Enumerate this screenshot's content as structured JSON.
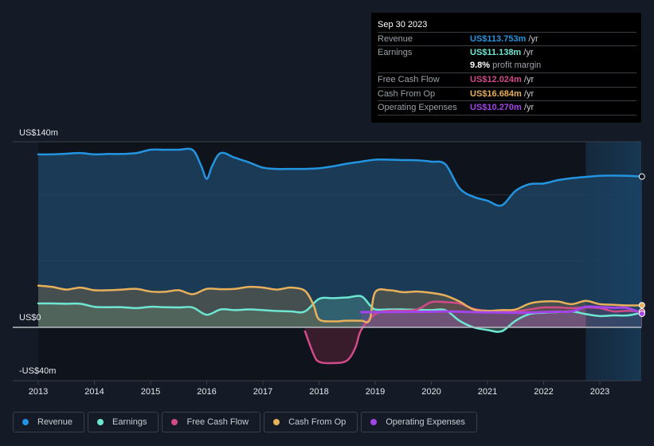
{
  "tooltip": {
    "date": "Sep 30 2023",
    "rows": [
      {
        "label": "Revenue",
        "value": "US$113.753m",
        "unit": " /yr",
        "color": "#2394df"
      },
      {
        "label": "Earnings",
        "value": "US$11.138m",
        "unit": " /yr",
        "color": "#6ee7d2"
      },
      {
        "label": "",
        "value": "9.8%",
        "unit": " profit margin",
        "color": "#ffffff"
      },
      {
        "label": "Free Cash Flow",
        "value": "US$12.024m",
        "unit": " /yr",
        "color": "#d14a8a"
      },
      {
        "label": "Cash From Op",
        "value": "US$16.684m",
        "unit": " /yr",
        "color": "#e8b05a"
      },
      {
        "label": "Operating Expenses",
        "value": "US$10.270m",
        "unit": " /yr",
        "color": "#a345e8"
      }
    ]
  },
  "legend": [
    {
      "label": "Revenue",
      "color": "#2394df"
    },
    {
      "label": "Earnings",
      "color": "#6ee7d2"
    },
    {
      "label": "Free Cash Flow",
      "color": "#d14a8a"
    },
    {
      "label": "Cash From Op",
      "color": "#e8b05a"
    },
    {
      "label": "Operating Expenses",
      "color": "#a345e8"
    }
  ],
  "chart_data": {
    "type": "area",
    "title": "",
    "xlabel": "",
    "ylabel": "",
    "ylim": [
      -40,
      140
    ],
    "xlim": [
      2012.6,
      2023.75
    ],
    "y_tick_labels": [
      {
        "value": 140,
        "label": "US$140m"
      },
      {
        "value": 0,
        "label": "US$0"
      },
      {
        "value": -40,
        "label": "-US$40m"
      }
    ],
    "x_tick_labels": [
      "2013",
      "2014",
      "2015",
      "2016",
      "2017",
      "2018",
      "2019",
      "2020",
      "2021",
      "2022",
      "2023"
    ],
    "grid": true,
    "highlight_region": [
      2022.75,
      2023.75
    ],
    "legend_position": "bottom-left",
    "series": [
      {
        "name": "Revenue",
        "color": "#2394df",
        "x": [
          2013.0,
          2013.25,
          2013.5,
          2013.75,
          2014.0,
          2014.25,
          2014.5,
          2014.75,
          2015.0,
          2015.25,
          2015.5,
          2015.75,
          2015.9,
          2016.0,
          2016.1,
          2016.25,
          2016.5,
          2016.75,
          2017.0,
          2017.25,
          2017.5,
          2017.75,
          2018.0,
          2018.25,
          2018.5,
          2018.75,
          2019.0,
          2019.25,
          2019.5,
          2019.75,
          2020.0,
          2020.25,
          2020.5,
          2020.75,
          2021.0,
          2021.25,
          2021.5,
          2021.75,
          2022.0,
          2022.25,
          2022.5,
          2022.75,
          2023.0,
          2023.25,
          2023.5,
          2023.75
        ],
        "values": [
          130.5,
          130.5,
          131,
          131.5,
          130.5,
          130.8,
          130.8,
          131.5,
          134,
          134,
          134,
          133.8,
          122,
          112,
          122,
          131.5,
          128,
          124.5,
          120.5,
          119.5,
          119.5,
          119.5,
          120,
          121.5,
          123.5,
          125,
          126.5,
          126.5,
          126.2,
          126,
          125,
          123,
          105,
          98.5,
          95.5,
          92,
          103,
          108,
          108.5,
          111,
          112.5,
          113.5,
          114.3,
          114.5,
          114.3,
          113.753
        ]
      },
      {
        "name": "Earnings",
        "color": "#6ee7d2",
        "x": [
          2013.0,
          2013.25,
          2013.5,
          2013.75,
          2014.0,
          2014.25,
          2014.5,
          2014.75,
          2015.0,
          2015.25,
          2015.5,
          2015.75,
          2016.0,
          2016.25,
          2016.5,
          2016.75,
          2017.0,
          2017.25,
          2017.5,
          2017.75,
          2018.0,
          2018.25,
          2018.5,
          2018.75,
          2018.9,
          2019.0,
          2019.25,
          2019.5,
          2019.75,
          2020.0,
          2020.25,
          2020.5,
          2020.75,
          2021.0,
          2021.25,
          2021.5,
          2021.75,
          2022.0,
          2022.25,
          2022.5,
          2022.75,
          2023.0,
          2023.25,
          2023.5,
          2023.75
        ],
        "values": [
          18,
          18,
          17.8,
          17.8,
          15.5,
          15.2,
          15.2,
          14.5,
          15.5,
          15.2,
          15,
          15,
          9.5,
          13.5,
          13,
          13.5,
          13,
          12.3,
          12,
          12,
          21.5,
          22,
          22.5,
          23.5,
          17,
          13.5,
          13.5,
          13.5,
          13.2,
          13,
          13,
          5,
          0,
          -2,
          -3,
          5,
          10,
          11,
          11.5,
          12,
          10,
          8.5,
          9,
          9,
          11.138
        ]
      },
      {
        "name": "Free Cash Flow",
        "color": "#d14a8a",
        "x": [
          2017.75,
          2017.9,
          2018.0,
          2018.25,
          2018.5,
          2018.65,
          2018.75,
          2019.0,
          2019.25,
          2019.5,
          2019.75,
          2020.0,
          2020.25,
          2020.5,
          2020.75,
          2021.0,
          2021.25,
          2021.5,
          2021.75,
          2022.0,
          2022.25,
          2022.5,
          2022.75,
          2023.0,
          2023.25,
          2023.5,
          2023.75
        ],
        "values": [
          -3,
          -20,
          -26,
          -27,
          -25,
          -15,
          -2,
          10,
          12.5,
          12.5,
          13.5,
          19,
          19,
          18,
          14,
          12.5,
          12.5,
          12,
          13.5,
          15,
          15,
          14.5,
          15,
          14.5,
          12,
          12.5,
          12.024
        ]
      },
      {
        "name": "Cash From Op",
        "color": "#e8b05a",
        "x": [
          2013.0,
          2013.25,
          2013.5,
          2013.75,
          2014.0,
          2014.25,
          2014.5,
          2014.75,
          2015.0,
          2015.25,
          2015.5,
          2015.75,
          2016.0,
          2016.25,
          2016.5,
          2016.75,
          2017.0,
          2017.25,
          2017.5,
          2017.75,
          2017.9,
          2018.0,
          2018.25,
          2018.5,
          2018.75,
          2018.9,
          2019.0,
          2019.25,
          2019.5,
          2019.75,
          2020.0,
          2020.25,
          2020.5,
          2020.75,
          2021.0,
          2021.25,
          2021.5,
          2021.75,
          2022.0,
          2022.25,
          2022.5,
          2022.75,
          2023.0,
          2023.25,
          2023.5,
          2023.75
        ],
        "values": [
          31.5,
          30.5,
          28.5,
          30,
          28,
          28,
          28.5,
          29,
          27,
          26.8,
          28,
          25,
          29,
          28.8,
          29,
          30.5,
          30,
          28.5,
          30,
          27.5,
          17,
          6,
          4.5,
          5,
          5,
          5.5,
          26.5,
          28,
          26.5,
          27,
          26,
          24,
          19.5,
          13.5,
          12.5,
          13,
          13.5,
          18,
          19.5,
          19.5,
          17.5,
          20,
          17.5,
          17,
          16.5,
          16.684
        ]
      },
      {
        "name": "Operating Expenses",
        "color": "#a345e8",
        "x": [
          2018.75,
          2019.0,
          2019.25,
          2019.5,
          2019.75,
          2020.0,
          2020.25,
          2020.5,
          2020.75,
          2021.0,
          2021.25,
          2021.5,
          2021.75,
          2022.0,
          2022.25,
          2022.5,
          2022.75,
          2023.0,
          2023.25,
          2023.5,
          2023.75
        ],
        "values": [
          11.5,
          11.5,
          11.5,
          11.6,
          11.7,
          11.8,
          12,
          11.8,
          11.5,
          11.3,
          11.2,
          11,
          11.2,
          11.5,
          11.8,
          12,
          15.5,
          15.2,
          14.8,
          14.5,
          10.27
        ]
      }
    ]
  }
}
